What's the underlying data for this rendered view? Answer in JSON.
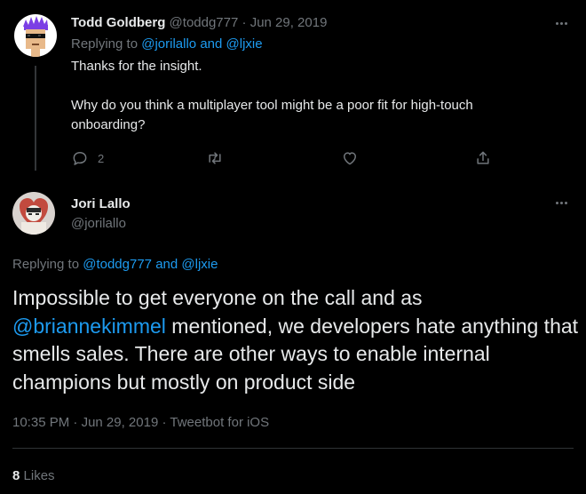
{
  "tweet1": {
    "name": "Todd Goldberg",
    "handle": "@toddg777",
    "sep": "·",
    "date": "Jun 29, 2019",
    "replying_prefix": "Replying to",
    "reply_to_1": "@jorilallo",
    "reply_and": "and",
    "reply_to_2": "@ljxie",
    "body_line1": "Thanks for the insight.",
    "body_line2": "Why do you think a multiplayer tool might be a poor fit for high-touch",
    "body_line3": "onboarding?",
    "reply_count": "2",
    "icons": [
      "reply-icon",
      "retweet-icon",
      "like-icon",
      "share-icon",
      "more-icon"
    ]
  },
  "tweet2": {
    "name": "Jori Lallo",
    "handle": "@jorilallo",
    "replying_prefix": "Replying to",
    "reply_to_1": "@toddg777",
    "reply_and": "and",
    "reply_to_2": "@ljxie",
    "body_pre": "Impossible to get everyone on the call and as",
    "body_mention": "@briannekimmel",
    "body_post": " mentioned, we developers hate anything that smells sales. There are other ways to enable internal champions but mostly on product side",
    "time": "10:35 PM",
    "date": "Jun 29, 2019",
    "sep": "·",
    "client": "Tweetbot for iOS",
    "likes_count": "8",
    "likes_label": "Likes"
  },
  "colors": {
    "background": "#000000",
    "text": "#e7e9ea",
    "muted": "#71767b",
    "link": "#1d9bf0",
    "divider": "#2f3336"
  }
}
